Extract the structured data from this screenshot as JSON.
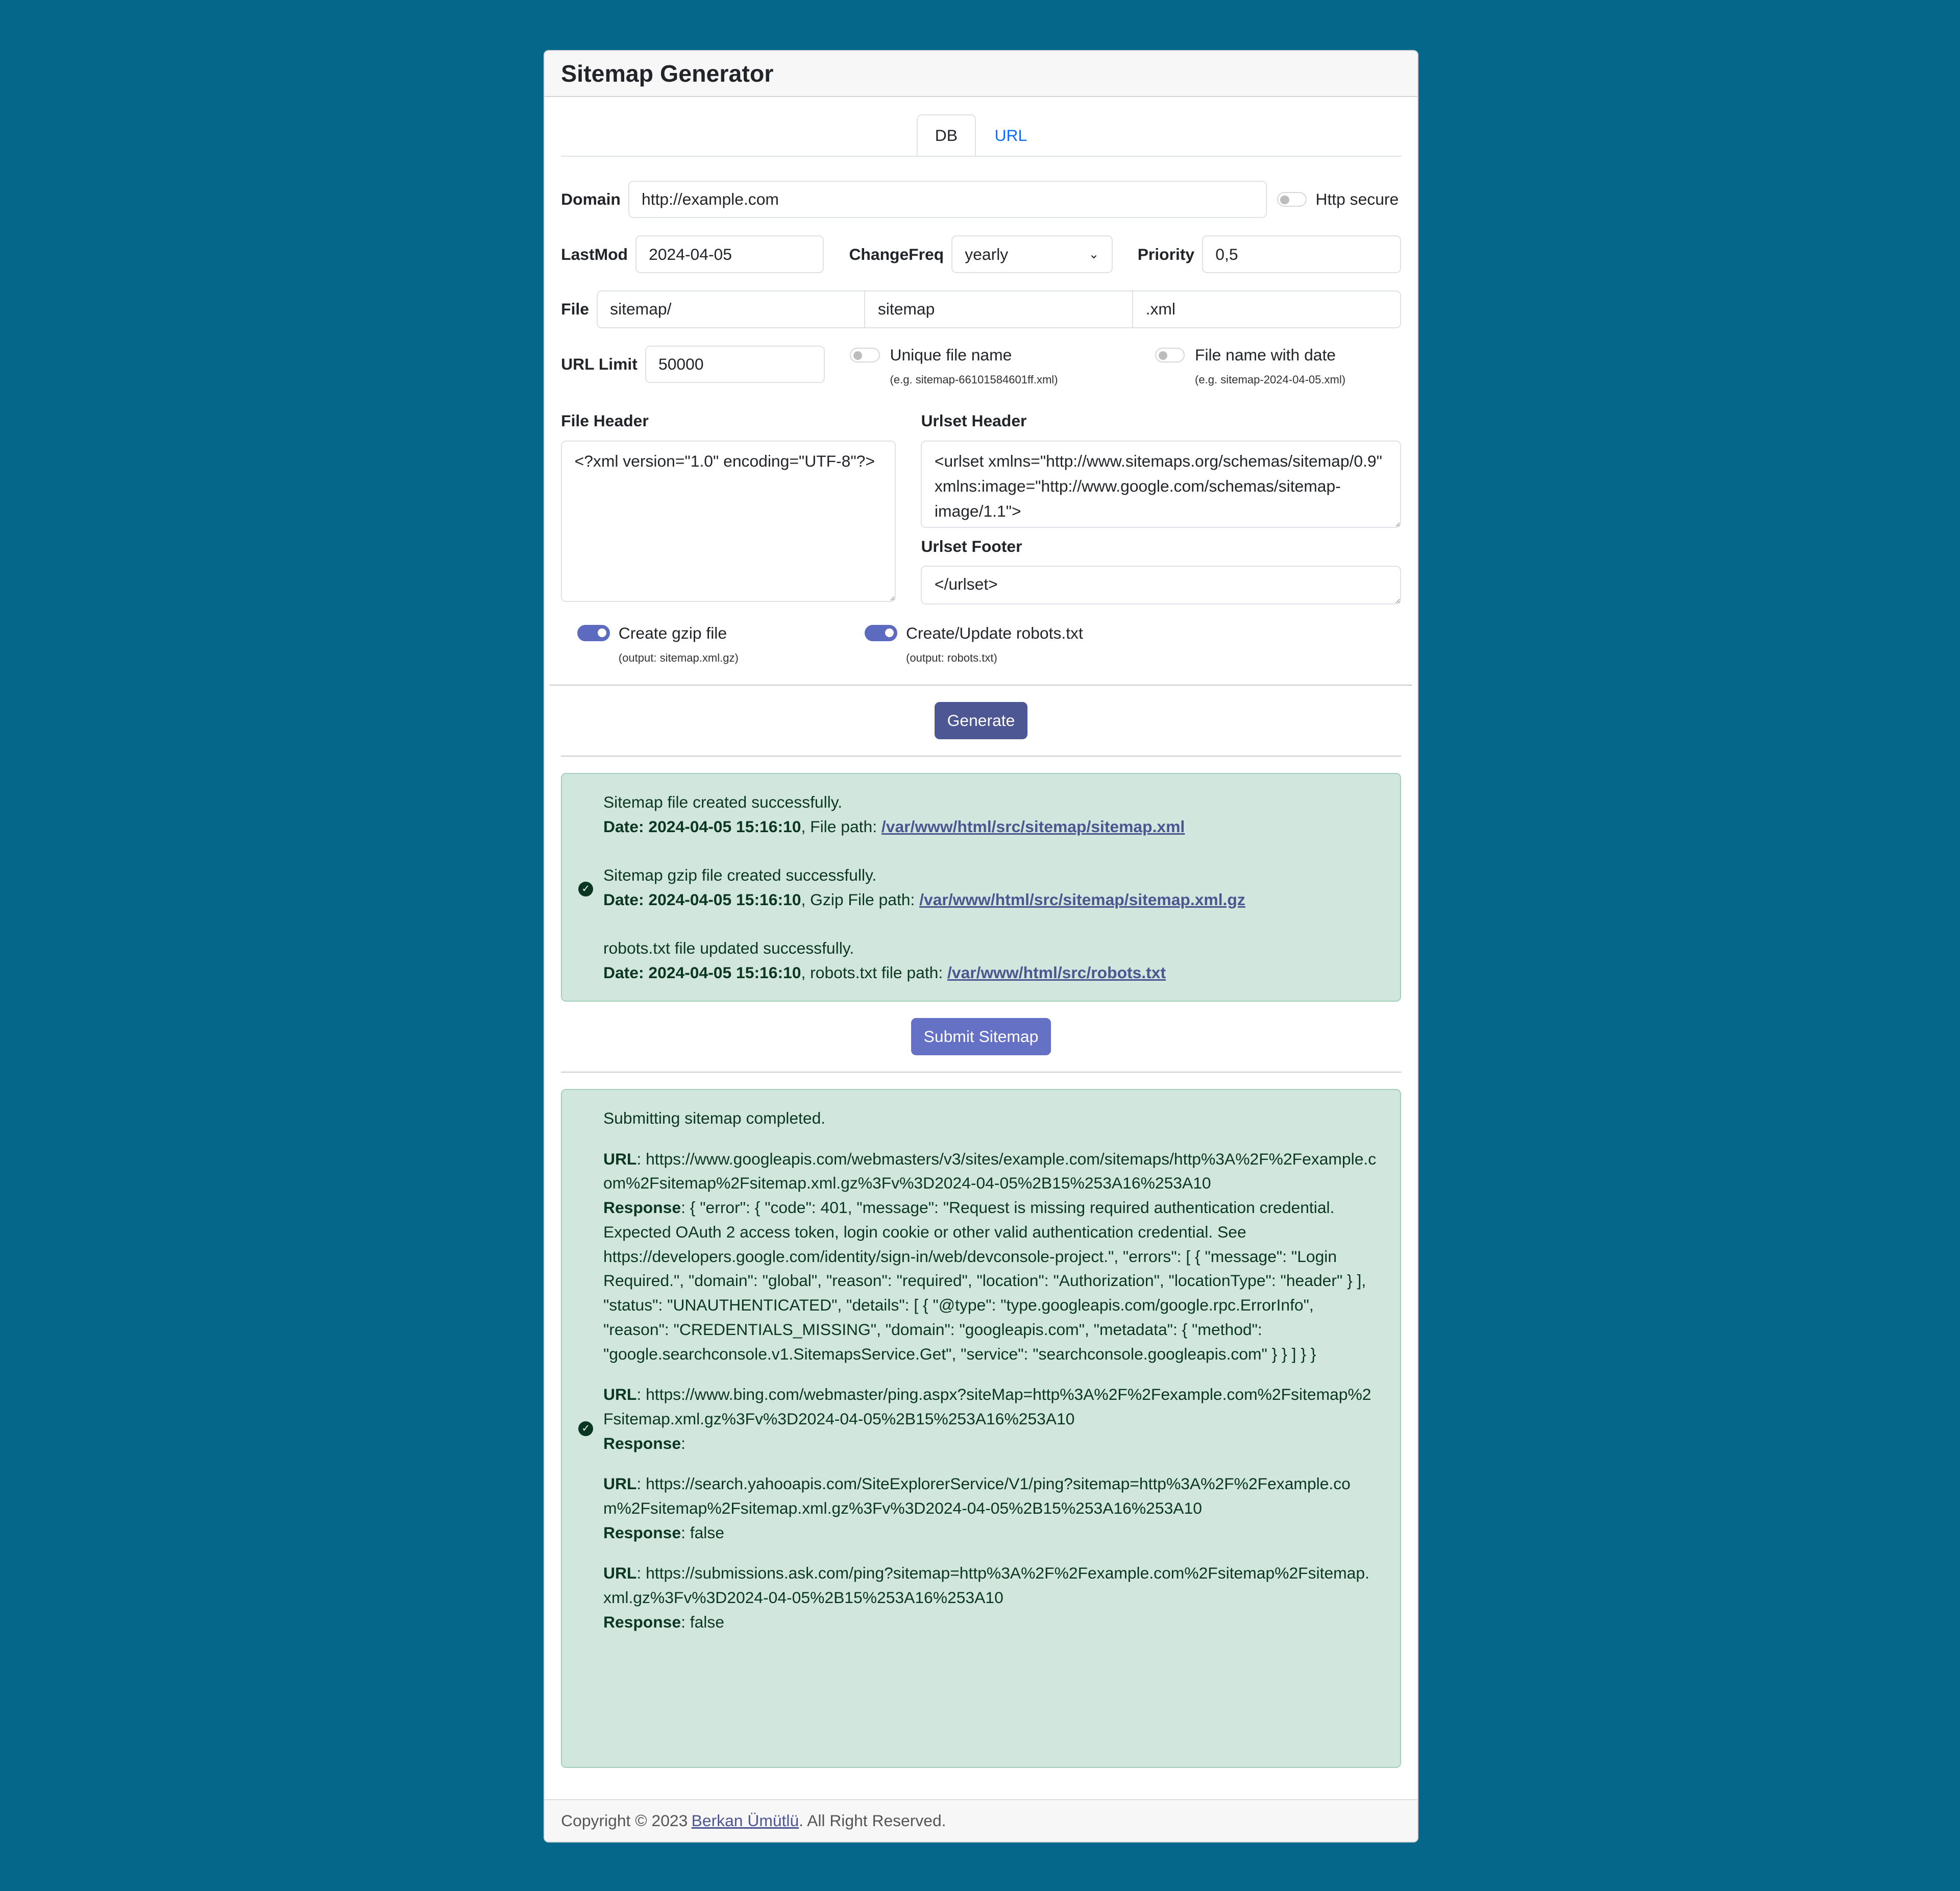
{
  "title": "Sitemap Generator",
  "tabs": [
    {
      "label": "DB",
      "active": true
    },
    {
      "label": "URL",
      "active": false
    }
  ],
  "form": {
    "domain_label": "Domain",
    "domain_value": "http://example.com",
    "http_secure_label": "Http secure",
    "http_secure_on": false,
    "lastmod_label": "LastMod",
    "lastmod_value": "2024-04-05",
    "changefreq_label": "ChangeFreq",
    "changefreq_value": "yearly",
    "priority_label": "Priority",
    "priority_value": "0,5",
    "file_label": "File",
    "file_dir": "sitemap/",
    "file_name": "sitemap",
    "file_ext": ".xml",
    "url_limit_label": "URL Limit",
    "url_limit_value": "50000",
    "unique_label": "Unique file name",
    "unique_hint": "(e.g. sitemap-66101584601ff.xml)",
    "unique_on": false,
    "date_label": "File name with date",
    "date_hint": "(e.g. sitemap-2024-04-05.xml)",
    "date_on": false,
    "file_header_label": "File Header",
    "file_header_value": "<?xml version=\"1.0\" encoding=\"UTF-8\"?>",
    "urlset_header_label": "Urlset Header",
    "urlset_header_value": "<urlset xmlns=\"http://www.sitemaps.org/schemas/sitemap/0.9\" xmlns:image=\"http://www.google.com/schemas/sitemap-image/1.1\">",
    "urlset_footer_label": "Urlset Footer",
    "urlset_footer_value": "</urlset>",
    "gzip_label": "Create gzip file",
    "gzip_hint": "(output: sitemap.xml.gz)",
    "gzip_on": true,
    "robots_label": "Create/Update robots.txt",
    "robots_hint": "(output: robots.txt)",
    "robots_on": true,
    "generate_label": "Generate"
  },
  "result": {
    "date_label": "Date:",
    "date": "2024-04-05 15:16:10",
    "msg1": "Sitemap file created successfully.",
    "path1_label": ", File path: ",
    "path1": "/var/www/html/src/sitemap/sitemap.xml",
    "msg2": "Sitemap gzip file created successfully.",
    "path2_label": ", Gzip File path: ",
    "path2": "/var/www/html/src/sitemap/sitemap.xml.gz",
    "msg3": "robots.txt file updated successfully.",
    "path3_label": ", robots.txt file path: ",
    "path3": "/var/www/html/src/robots.txt"
  },
  "submit_label": "Submit Sitemap",
  "submission": {
    "title": "Submitting sitemap completed.",
    "url_label": "URL",
    "response_label": "Response",
    "items": [
      {
        "url": "https://www.googleapis.com/webmasters/v3/sites/example.com/sitemaps/http%3A%2F%2Fexample.com%2Fsitemap%2Fsitemap.xml.gz%3Fv%3D2024-04-05%2B15%253A16%253A10",
        "response": "{ \"error\": { \"code\": 401, \"message\": \"Request is missing required authentication credential. Expected OAuth 2 access token, login cookie or other valid authentication credential. See https://developers.google.com/identity/sign-in/web/devconsole-project.\", \"errors\": [ { \"message\": \"Login Required.\", \"domain\": \"global\", \"reason\": \"required\", \"location\": \"Authorization\", \"locationType\": \"header\" } ], \"status\": \"UNAUTHENTICATED\", \"details\": [ { \"@type\": \"type.googleapis.com/google.rpc.ErrorInfo\", \"reason\": \"CREDENTIALS_MISSING\", \"domain\": \"googleapis.com\", \"metadata\": { \"method\": \"google.searchconsole.v1.SitemapsService.Get\", \"service\": \"searchconsole.googleapis.com\" } } ] } }"
      },
      {
        "url": "https://www.bing.com/webmaster/ping.aspx?siteMap=http%3A%2F%2Fexample.com%2Fsitemap%2Fsitemap.xml.gz%3Fv%3D2024-04-05%2B15%253A16%253A10",
        "response": ""
      },
      {
        "url": "https://search.yahooapis.com/SiteExplorerService/V1/ping?sitemap=http%3A%2F%2Fexample.com%2Fsitemap%2Fsitemap.xml.gz%3Fv%3D2024-04-05%2B15%253A16%253A10",
        "response": "false"
      },
      {
        "url": "https://submissions.ask.com/ping?sitemap=http%3A%2F%2Fexample.com%2Fsitemap%2Fsitemap.xml.gz%3Fv%3D2024-04-05%2B15%253A16%253A10",
        "response": "false"
      }
    ]
  },
  "footer": {
    "prefix": "Copyright © 2023 ",
    "author": "Berkan Ümütlü",
    "suffix": ". All Right Reserved."
  },
  "colors": {
    "background": "#05688b",
    "generate": "#4c5794",
    "submit": "#6471c4",
    "alert_bg": "#d1e7dd",
    "tab_link": "#0d6efd"
  }
}
